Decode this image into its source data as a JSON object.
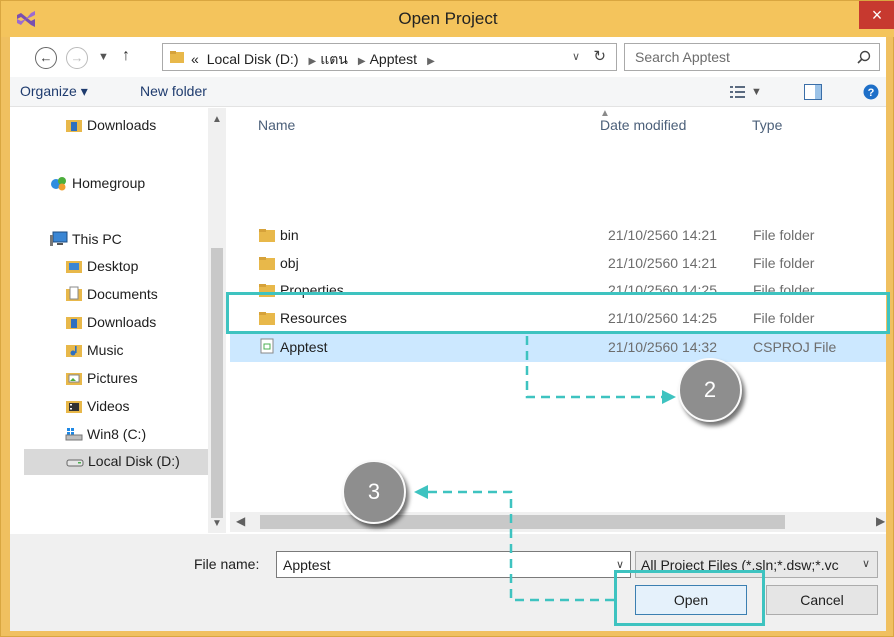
{
  "window": {
    "title": "Open Project",
    "close_glyph": "×"
  },
  "address": {
    "overflow": "«",
    "segments": [
      "Local Disk (D:)",
      "แตน",
      "Apptest"
    ],
    "dropdown": "∨",
    "refresh": "↻"
  },
  "search": {
    "placeholder": "Search Apptest"
  },
  "toolbar": {
    "organize_label": "Organize ▾",
    "new_folder_label": "New folder"
  },
  "nav_pane": {
    "items": [
      {
        "label": "Downloads",
        "icon": "downloads-folder-icon"
      },
      {
        "label": "Homegroup",
        "icon": "homegroup-icon"
      },
      {
        "label": "This PC",
        "icon": "computer-icon"
      },
      {
        "label": "Desktop",
        "icon": "desktop-folder-icon"
      },
      {
        "label": "Documents",
        "icon": "documents-folder-icon"
      },
      {
        "label": "Downloads",
        "icon": "downloads-folder-icon"
      },
      {
        "label": "Music",
        "icon": "music-folder-icon"
      },
      {
        "label": "Pictures",
        "icon": "pictures-folder-icon"
      },
      {
        "label": "Videos",
        "icon": "videos-folder-icon"
      },
      {
        "label": "Win8 (C:)",
        "icon": "system-drive-icon"
      },
      {
        "label": "Local Disk (D:)",
        "icon": "drive-icon",
        "selected": true
      }
    ]
  },
  "file_list": {
    "columns": {
      "name": "Name",
      "date": "Date modified",
      "type": "Type"
    },
    "rows": [
      {
        "name": "bin",
        "date": "21/10/2560 14:21",
        "type": "File folder",
        "icon": "folder-icon"
      },
      {
        "name": "obj",
        "date": "21/10/2560 14:21",
        "type": "File folder",
        "icon": "folder-icon"
      },
      {
        "name": "Properties",
        "date": "21/10/2560 14:25",
        "type": "File folder",
        "icon": "folder-icon"
      },
      {
        "name": "Resources",
        "date": "21/10/2560 14:25",
        "type": "File folder",
        "icon": "folder-icon"
      },
      {
        "name": "Apptest",
        "date": "21/10/2560 14:32",
        "type": "CSPROJ File",
        "icon": "project-file-icon",
        "selected": true
      }
    ]
  },
  "bottom": {
    "file_name_label": "File name:",
    "file_name_value": "Apptest",
    "filter_value": "All Project Files (*.sln;*.dsw;*.vc",
    "open_label": "Open",
    "cancel_label": "Cancel"
  },
  "annotations": {
    "step_2": "2",
    "step_3": "3",
    "highlight_color": "#3ec3c0"
  }
}
